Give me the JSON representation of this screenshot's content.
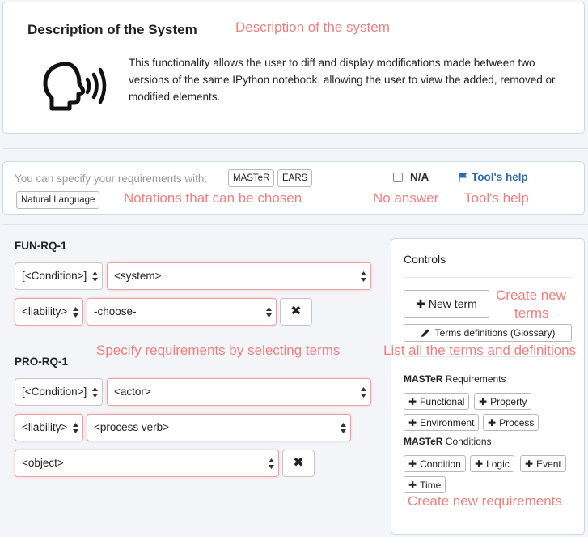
{
  "description": {
    "title": "Description of the System",
    "annotation": "Description of the system",
    "text": "This functionality allows the user to diff and display modifications made between two versions of the same IPython notebook, allowing the user to view the added, removed or modified elements."
  },
  "notation": {
    "label": "You can specify your requirements with:",
    "options": [
      "MASTeR",
      "EARS",
      "Natural Language"
    ],
    "na_label": "N/A",
    "help_label": "Tool's help",
    "annotations": {
      "notations": "Notations that can be chosen",
      "no_answer": "No answer",
      "help": "Tool's help"
    }
  },
  "requirements": {
    "annotation": "Specify requirements by selecting terms",
    "fun": {
      "id": "FUN-RQ-1",
      "condition": "[<Condition>]",
      "system": "<system>",
      "liability": "<liability>",
      "choose": "-choose-",
      "remove": "✖"
    },
    "pro": {
      "id": "PRO-RQ-1",
      "condition": "[<Condition>]",
      "actor": "<actor>",
      "liability": "<liability>",
      "process_verb": "<process verb>",
      "object": "<object>",
      "remove": "✖"
    }
  },
  "controls": {
    "title": "Controls",
    "new_term": "New term",
    "terms_definitions": "Terms definitions (Glossary)",
    "master_requirements": "Requirements",
    "master_conditions": "Conditions",
    "master_prefix": "MASTeR",
    "req_buttons": [
      "Functional",
      "Property",
      "Environment",
      "Process"
    ],
    "cond_buttons": [
      "Condition",
      "Logic",
      "Event",
      "Time"
    ],
    "annotations": {
      "new_term_1": "Create new",
      "new_term_2": "terms",
      "terms_list": "List all the terms and definitions",
      "new_reqs": "Create new requirements"
    }
  },
  "colors": {
    "annotation": "#f08080",
    "link": "#2a6bb5",
    "select_border": "#f0a0a0"
  }
}
